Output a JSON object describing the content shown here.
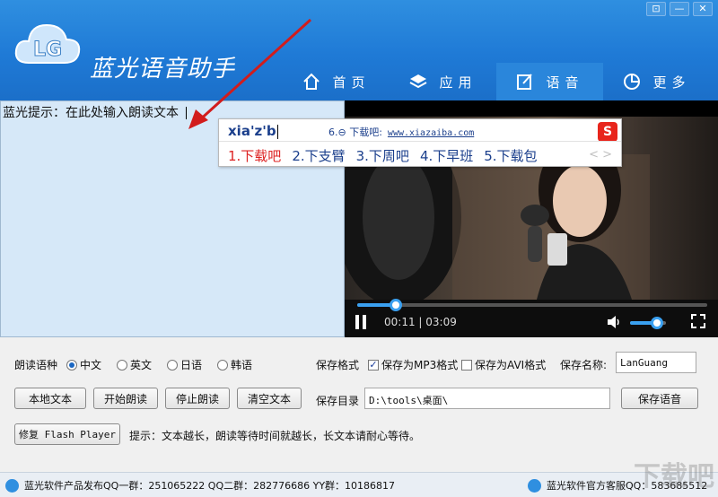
{
  "app": {
    "title": "蓝光语音助手",
    "logo_text": "LG",
    "window_controls": [
      "⊡",
      "—",
      "✕"
    ]
  },
  "nav": [
    {
      "label": "首页",
      "icon": "home-icon",
      "active": false
    },
    {
      "label": "应用",
      "icon": "layers-icon",
      "active": false
    },
    {
      "label": "语音",
      "icon": "edit-icon",
      "active": true
    },
    {
      "label": "更多",
      "icon": "pie-chart-icon",
      "active": false
    }
  ],
  "text_area": {
    "tip": "蓝光提示：在此处输入朗读文本"
  },
  "ime": {
    "input": "xia'z'b",
    "extra_candidate": "6.⊖ 下载吧:",
    "extra_url": "www.xiazaiba.com",
    "logo": "S",
    "candidates": [
      "1.下载吧",
      "2.下支臂",
      "3.下周吧",
      "4.下早班",
      "5.下载包"
    ],
    "arrows": "< >"
  },
  "video": {
    "current_time": "00:11",
    "duration": "03:09",
    "time_display": "00:11 | 03:09",
    "progress": 0.11,
    "volume": 0.75
  },
  "options": {
    "language_label": "朗读语种",
    "languages": [
      {
        "label": "中文",
        "selected": true
      },
      {
        "label": "英文",
        "selected": false
      },
      {
        "label": "日语",
        "selected": false
      },
      {
        "label": "韩语",
        "selected": false
      }
    ],
    "save_format_label": "保存格式",
    "format_mp3": {
      "label": "保存为MP3格式",
      "checked": true
    },
    "format_avi": {
      "label": "保存为AVI格式",
      "checked": false
    },
    "save_name_label": "保存名称:",
    "save_name_value": "LanGuang",
    "save_dir_label": "保存目录",
    "save_dir_value": "D:\\tools\\桌面\\",
    "buttons": {
      "local_text": "本地文本",
      "start_read": "开始朗读",
      "stop_read": "停止朗读",
      "clear_text": "清空文本",
      "save_voice": "保存语音",
      "fix_flash": "修复 Flash Player"
    },
    "hint": "提示：文本越长，朗读等待时间就越长，长文本请耐心等待。"
  },
  "status_bar": {
    "left": "蓝光软件产品发布QQ一群：251065222  QQ二群：282776686  YY群：10186817",
    "right": "蓝光软件官方客服QQ：583685512"
  },
  "watermark": "下载吧",
  "colors": {
    "header": "#1f7ad6",
    "accent": "#3aa0f0",
    "text_pane": "#d6e8f8"
  }
}
